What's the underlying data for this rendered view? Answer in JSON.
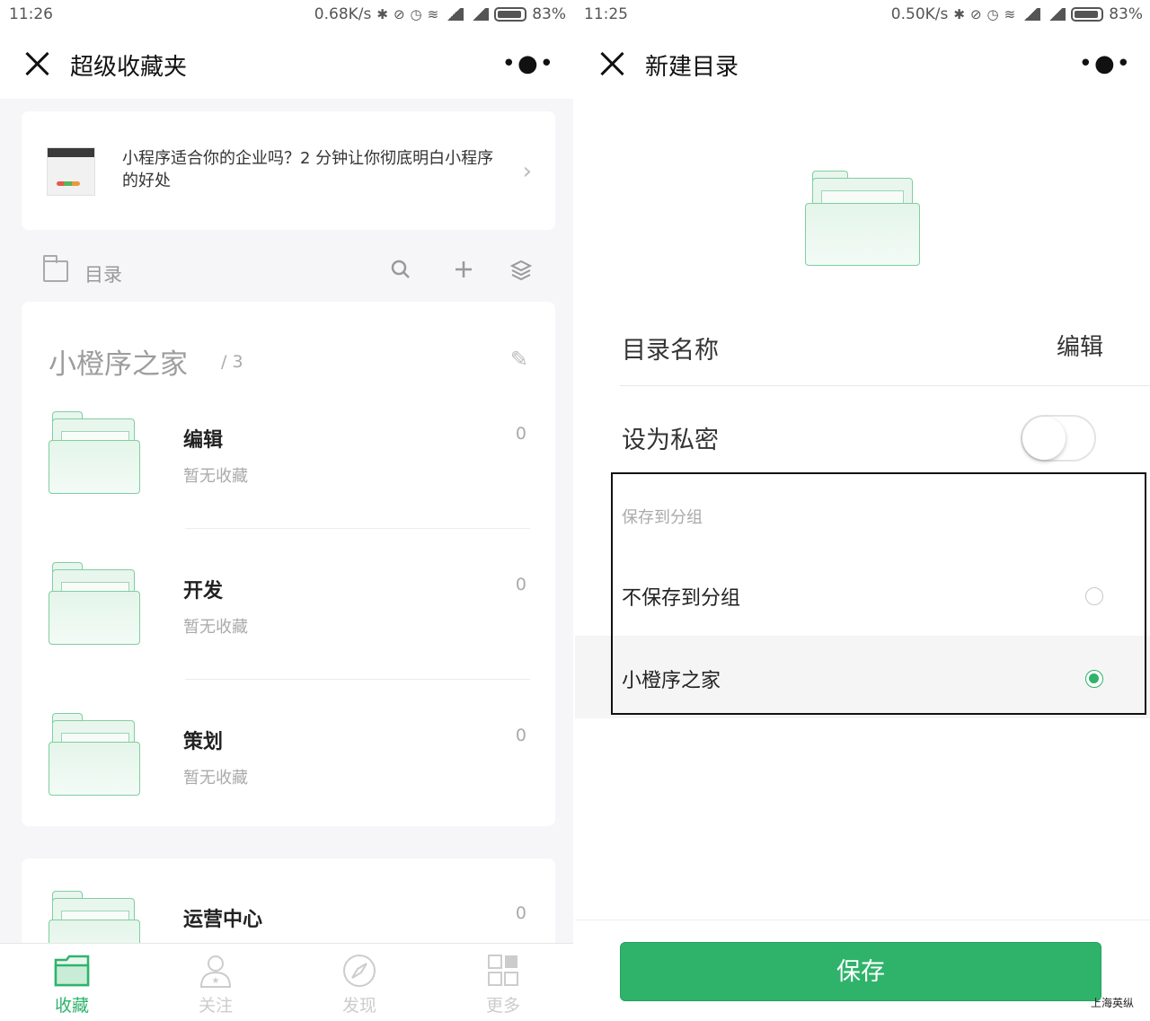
{
  "left": {
    "status": {
      "time": "11:26",
      "speed": "0.68K/s",
      "battery": "83%"
    },
    "nav": {
      "title": "超级收藏夹"
    },
    "promo": {
      "text": "小程序适合你的企业吗？2 分钟让你彻底明白小程序的好处"
    },
    "toolbar": {
      "label": "目录"
    },
    "group": {
      "name": "小橙序之家",
      "count": "/ 3",
      "folders": [
        {
          "name": "编辑",
          "sub": "暂无收藏",
          "count": "0"
        },
        {
          "name": "开发",
          "sub": "暂无收藏",
          "count": "0"
        },
        {
          "name": "策划",
          "sub": "暂无收藏",
          "count": "0"
        }
      ]
    },
    "second_group": {
      "folder": {
        "name": "运营中心",
        "count": "0"
      }
    },
    "tabs": [
      {
        "label": "收藏"
      },
      {
        "label": "关注"
      },
      {
        "label": "发现"
      },
      {
        "label": "更多"
      }
    ]
  },
  "right": {
    "status": {
      "time": "11:25",
      "speed": "0.50K/s",
      "battery": "83%"
    },
    "nav": {
      "title": "新建目录"
    },
    "fields": {
      "name_label": "目录名称",
      "name_value": "编辑",
      "private_label": "设为私密"
    },
    "group_section": {
      "header": "保存到分组",
      "options": [
        {
          "label": "不保存到分组",
          "selected": false
        },
        {
          "label": "小橙序之家",
          "selected": true
        }
      ]
    },
    "save_label": "保存",
    "watermark": "上海英纵"
  },
  "colors": {
    "accent": "#2fb36b",
    "folder_stroke": "#7fcf9f"
  }
}
